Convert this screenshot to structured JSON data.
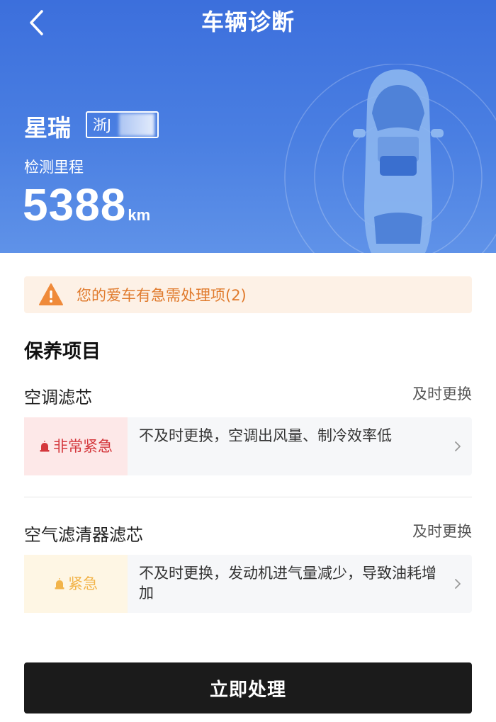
{
  "header": {
    "title": "车辆诊断",
    "back_icon": "chevron-left-icon"
  },
  "vehicle": {
    "name": "星瑞",
    "plate": "浙J",
    "mileage_label": "检测里程",
    "mileage_value": "5388",
    "mileage_unit": "km"
  },
  "alert": {
    "text": "您的爱车有急需处理项(2)",
    "icon": "warning-triangle-icon",
    "color": "#e07a2c"
  },
  "maintenance": {
    "section_title": "保养项目",
    "items": [
      {
        "name": "空调滤芯",
        "action": "及时更换",
        "level": "非常紧急",
        "level_color": "#d4373c",
        "description": "不及时更换，空调出风量、制冷效率低"
      },
      {
        "name": "空气滤清器滤芯",
        "action": "及时更换",
        "level": "紧急",
        "level_color": "#f2b44a",
        "description": "不及时更换，发动机进气量减少，导致油耗增加"
      }
    ]
  },
  "footer": {
    "button_label": "立即处理"
  },
  "colors": {
    "header_blue": "#3c6fdc",
    "button_dark": "#1b1b1b"
  }
}
